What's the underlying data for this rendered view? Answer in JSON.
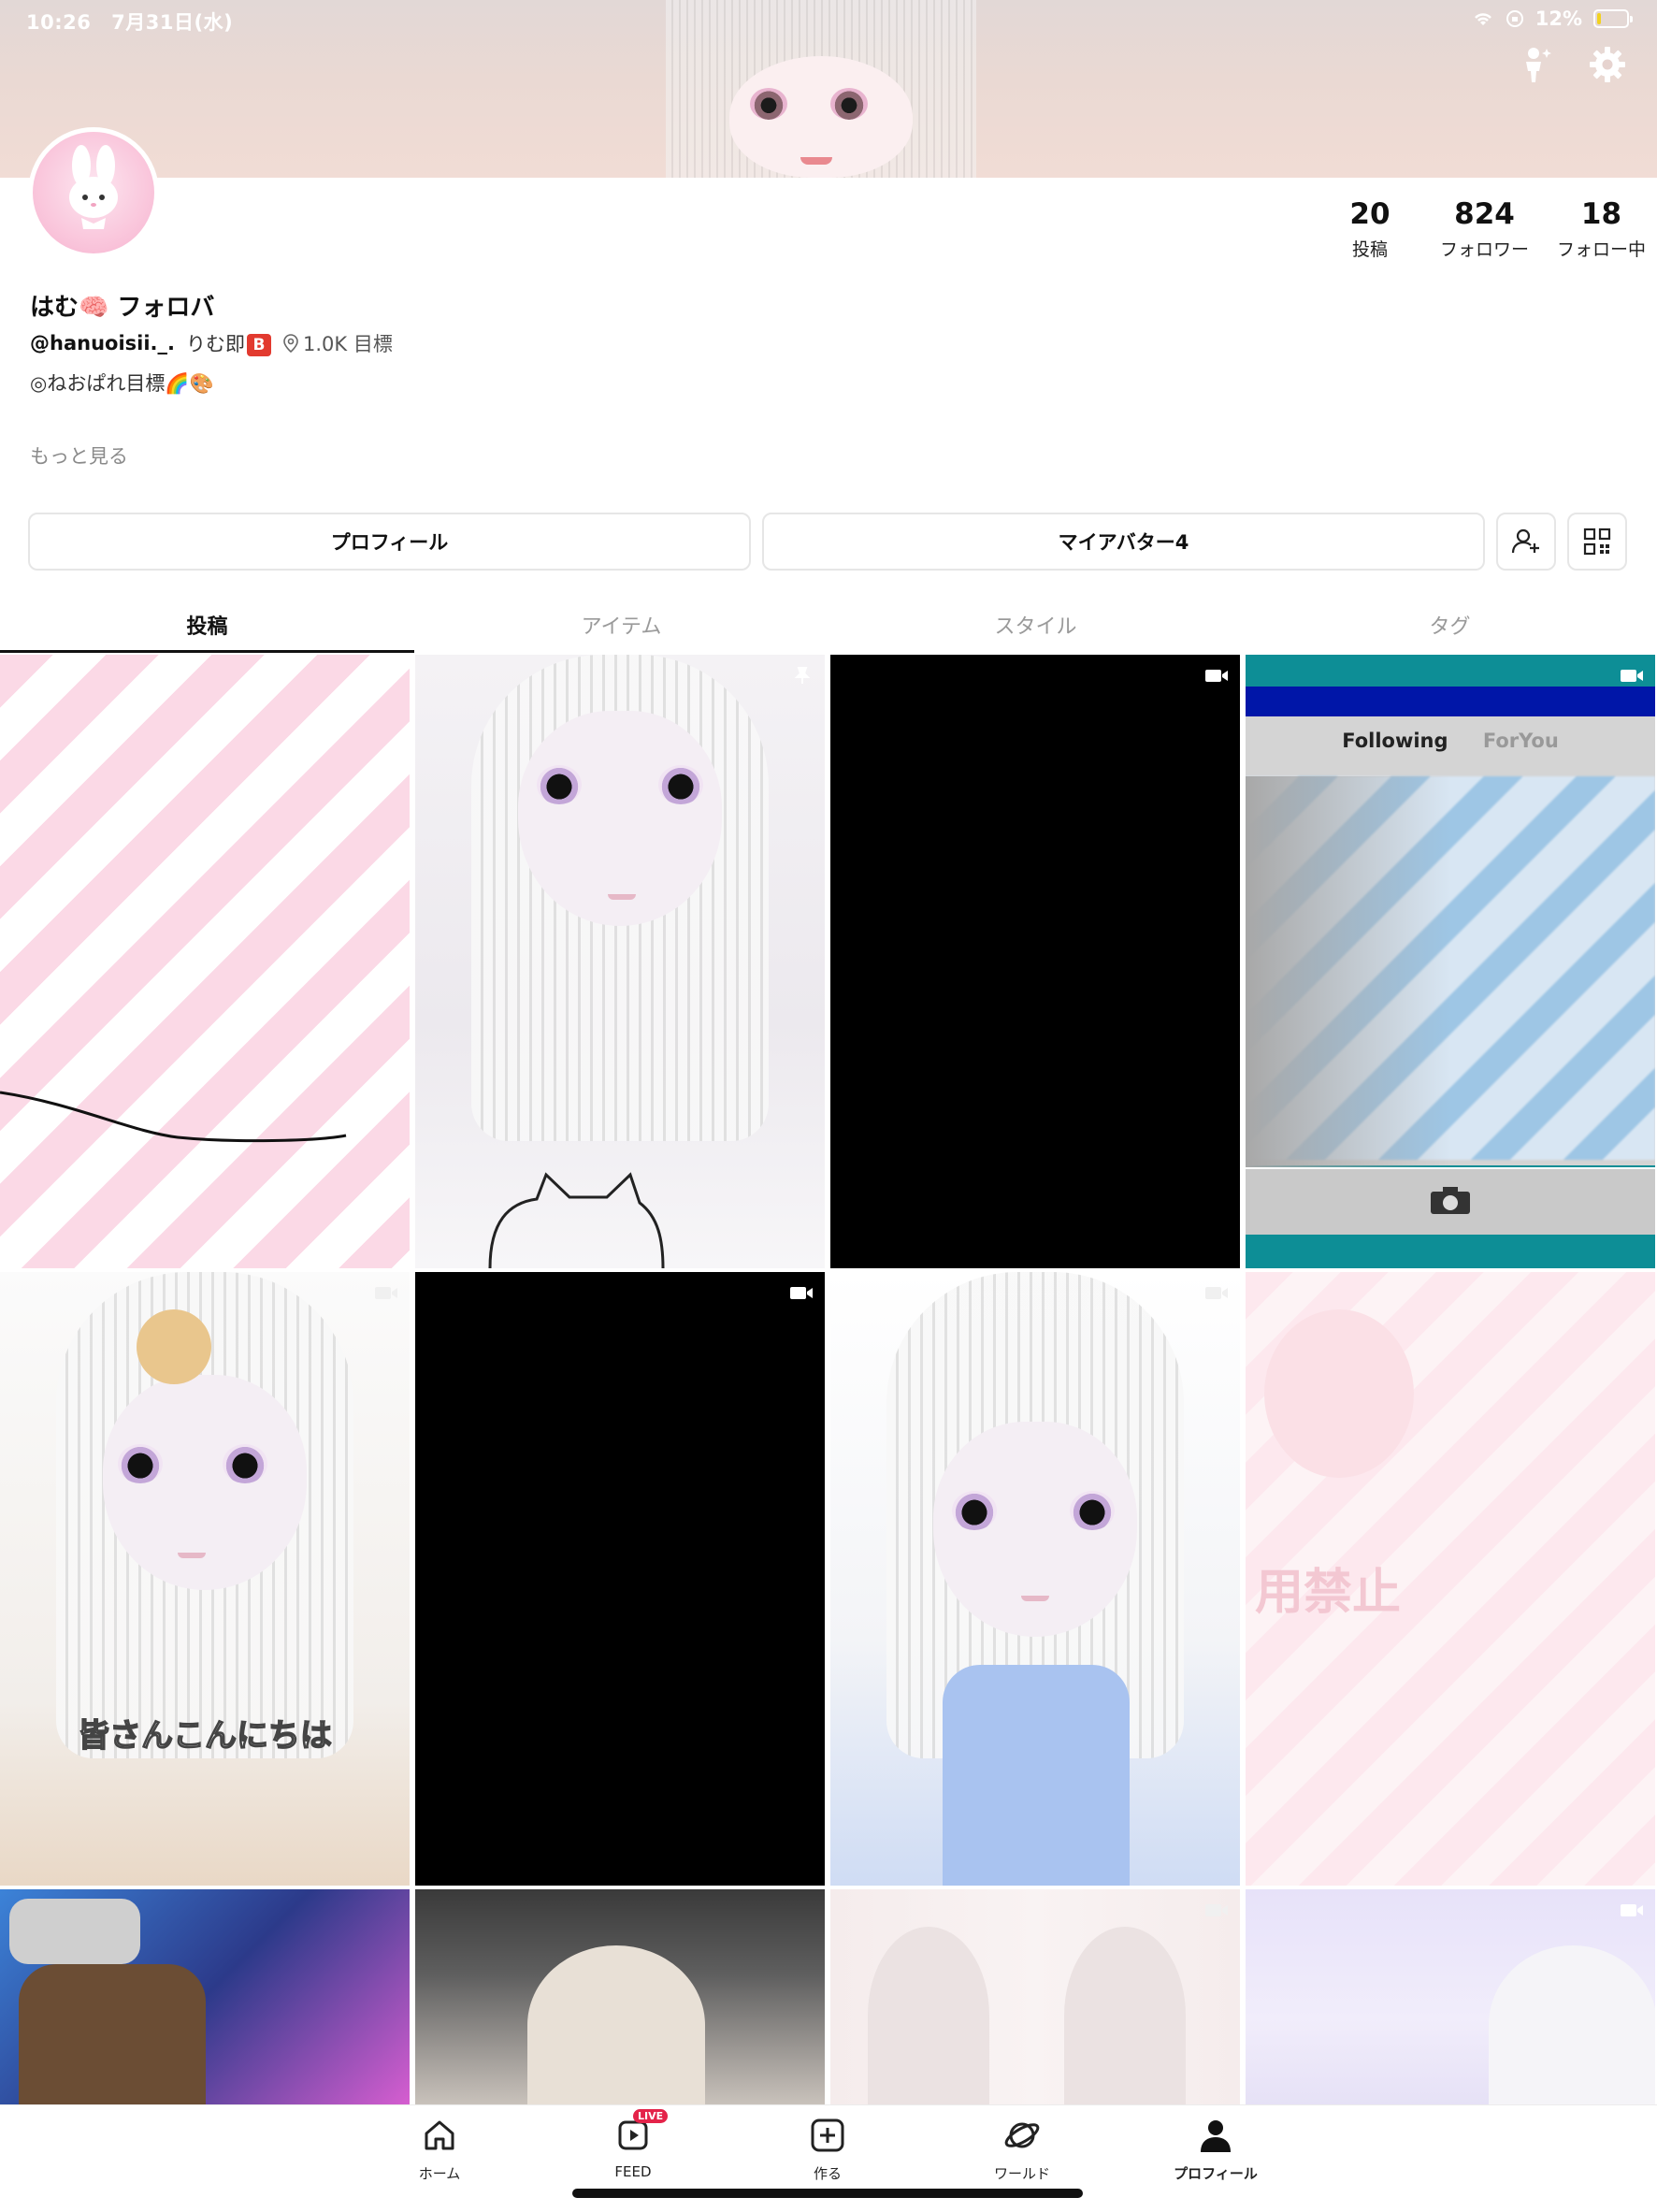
{
  "status_bar": {
    "time": "10:26",
    "date": "7月31日(水)",
    "battery": "12%",
    "battery_level": 0.12
  },
  "header_icons": {
    "avatar_icon": "person-sparkle-icon",
    "settings_icon": "gear-icon"
  },
  "profile": {
    "name": "はむ🧠 フォロバ",
    "handle": "@hanuoisii._.",
    "handle_extra": "りむ即",
    "badge": "B",
    "location": "1.0K 目標",
    "bio": "◎ねおぱれ目標🌈🎨",
    "see_more": "もっと見る"
  },
  "stats": [
    {
      "value": "20",
      "label": "投稿"
    },
    {
      "value": "824",
      "label": "フォロワー"
    },
    {
      "value": "18",
      "label": "フォロー中"
    }
  ],
  "buttons": {
    "profile": "プロフィール",
    "my_avatar": "マイアバター4"
  },
  "tabs": [
    {
      "label": "投稿",
      "active": true
    },
    {
      "label": "アイテム",
      "active": false
    },
    {
      "label": "スタイル",
      "active": false
    },
    {
      "label": "タグ",
      "active": false
    }
  ],
  "grid": {
    "tile_2_caption": "皆さんこんにちは",
    "tile_4_tabs": [
      "Following",
      "ForYou"
    ],
    "tile_8_text": "用禁止"
  },
  "nav": [
    {
      "label": "ホーム",
      "icon": "home-icon"
    },
    {
      "label": "FEED",
      "icon": "feed-icon",
      "badge": "LIVE"
    },
    {
      "label": "作る",
      "icon": "create-icon"
    },
    {
      "label": "ワールド",
      "icon": "world-icon"
    },
    {
      "label": "プロフィール",
      "icon": "profile-icon",
      "active": true
    }
  ],
  "colors": {
    "accent_live": "#e4234a",
    "badge_red": "#e23a2f",
    "active_tab": "#111111",
    "inactive_tab": "#9a9a9a"
  }
}
